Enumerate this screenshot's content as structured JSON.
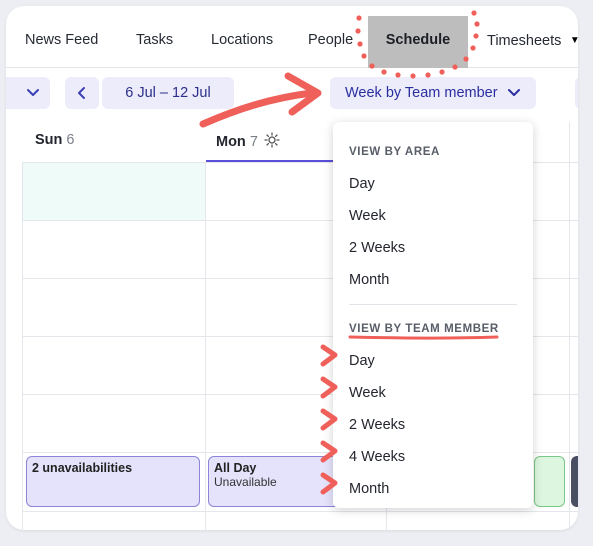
{
  "nav": {
    "items": [
      "News Feed",
      "Tasks",
      "Locations",
      "People",
      "Schedule",
      "Timesheets"
    ],
    "active": "Schedule"
  },
  "controls": {
    "date_range": "6 Jul – 12 Jul",
    "view_label": "Week by Team member"
  },
  "days": [
    {
      "name": "Sun",
      "num": "6"
    },
    {
      "name": "Mon",
      "num": "7"
    }
  ],
  "events": [
    {
      "title": "2 unavailabilities",
      "sub": ""
    },
    {
      "title": "All Day",
      "sub": "Unavailable"
    }
  ],
  "dropdown": {
    "area_heading": "VIEW BY AREA",
    "area_items": [
      "Day",
      "Week",
      "2 Weeks",
      "Month"
    ],
    "member_heading": "VIEW BY TEAM MEMBER",
    "member_items": [
      "Day",
      "Week",
      "2 Weeks",
      "4 Weeks",
      "Month"
    ]
  },
  "colors": {
    "accent": "#5a4fd8",
    "annotation": "#f0605a",
    "active_tab_bg": "#bdbdbd"
  },
  "icons": [
    "chevron-down-icon",
    "chevron-left-icon",
    "sun-icon"
  ]
}
